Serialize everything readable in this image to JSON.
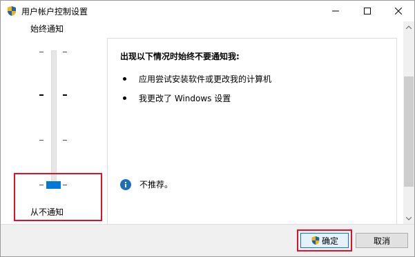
{
  "window": {
    "title": "用户帐户控制设置",
    "title_icon": "uac-shield-icon",
    "controls": [
      "minimize-icon",
      "maximize-icon",
      "close-icon"
    ]
  },
  "slider": {
    "top_label": "始终通知",
    "bottom_label": "从不通知",
    "levels": 4,
    "selected_level": 1,
    "accent": "#0078d7",
    "highlight_color": "#e0102a"
  },
  "description": {
    "heading": "出现以下情况时始终不要通知我:",
    "bullets": [
      "应用尝试安装软件或更改我的计算机",
      "我更改了 Windows 设置"
    ],
    "info_icon": "info-icon",
    "recommendation": "不推荐。",
    "info_color": "#1e6fb8"
  },
  "footer": {
    "ok_label": "确定",
    "ok_icon": "uac-shield-icon",
    "cancel_label": "取消"
  }
}
